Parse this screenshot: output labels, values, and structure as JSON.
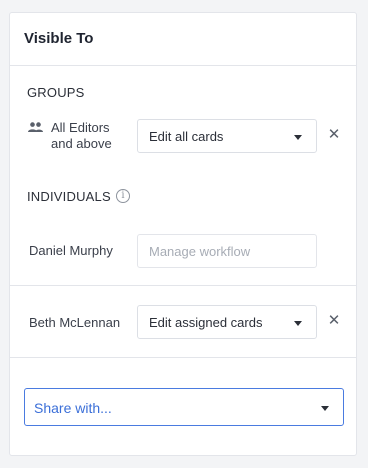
{
  "panel": {
    "title": "Visible To"
  },
  "groups": {
    "heading": "GROUPS",
    "items": [
      {
        "icon": "people-icon",
        "label_line1": "All Editors",
        "label_line2": "and above",
        "permission": "Edit all cards"
      }
    ]
  },
  "individuals": {
    "heading": "INDIVIDUALS",
    "info_icon": "info-icon",
    "info_glyph": "i",
    "items": [
      {
        "name": "Daniel Murphy",
        "permission_placeholder": "Manage workflow",
        "disabled": true
      },
      {
        "name": "Beth McLennan",
        "permission": "Edit assigned cards"
      }
    ]
  },
  "share": {
    "placeholder": "Share with..."
  },
  "colors": {
    "accent": "#3b6fd8",
    "border": "#e3e5ea"
  }
}
